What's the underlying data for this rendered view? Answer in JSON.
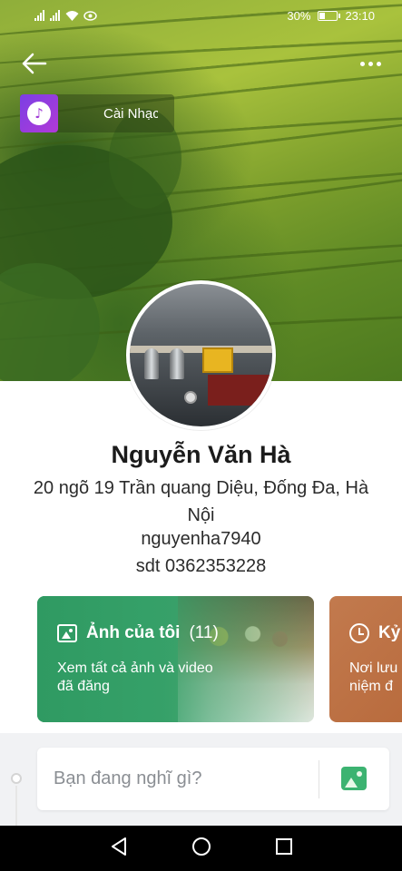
{
  "status_bar": {
    "battery": "30%",
    "battery_level": 0.3,
    "time": "23:10"
  },
  "cover": {
    "music_label": "Cài Nhạc"
  },
  "profile": {
    "name": "Nguyễn Văn Hà",
    "address": "20 ngõ 19 Trần quang Diệu, Đống Đa, Hà Nội",
    "username": "nguyenha7940",
    "phone": "sdt 0362353228"
  },
  "cards": {
    "photos": {
      "title": "Ảnh của tôi",
      "count": "(11)",
      "desc_line1": "Xem tất cả ảnh và video",
      "desc_line2": "đã đăng"
    },
    "memories": {
      "title": "Kỷ",
      "desc_line1": "Nơi lưu",
      "desc_line2": "niệm đ"
    }
  },
  "composer": {
    "placeholder": "Bạn đang nghĩ gì?"
  },
  "icons": {
    "back": "arrow-left-icon",
    "more": "more-dots-icon",
    "music": "music-note-icon",
    "photo": "image-icon",
    "clock": "clock-icon",
    "nav_back": "triangle-back-icon",
    "nav_home": "circle-home-icon",
    "nav_recent": "square-recent-icon"
  },
  "colors": {
    "photos_card": "#2f9a62",
    "memories_card": "#c27a4e",
    "accent_green": "#3cb371"
  }
}
